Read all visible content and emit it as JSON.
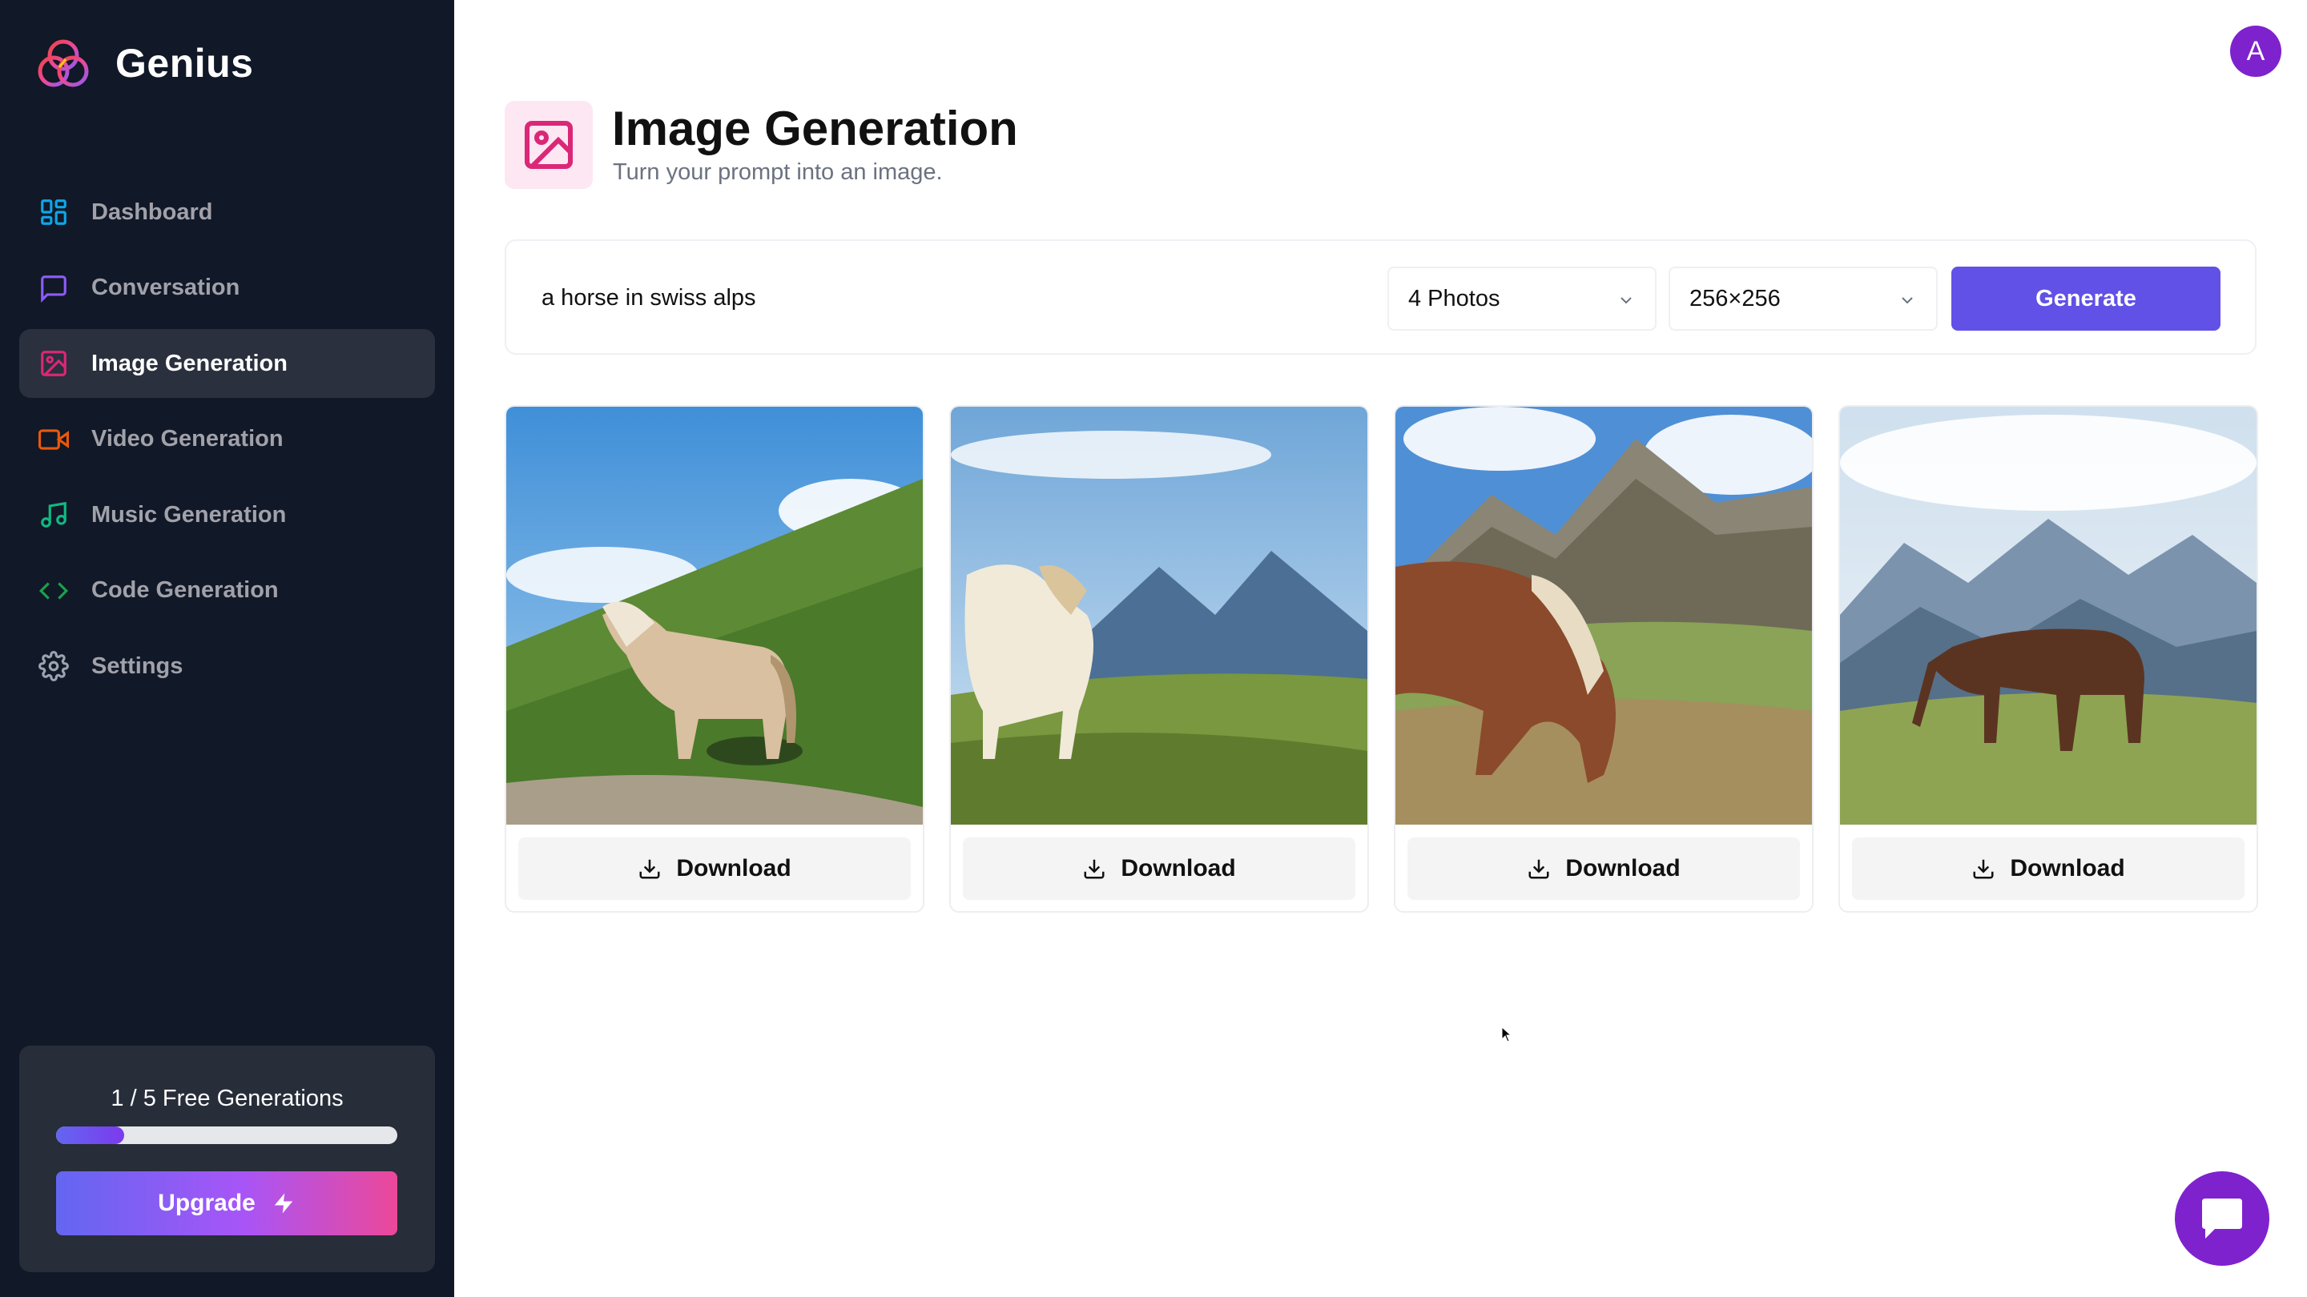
{
  "app": {
    "name": "Genius"
  },
  "sidebar": {
    "items": [
      {
        "label": "Dashboard",
        "icon": "dashboard-icon",
        "color": "#0ea5e9",
        "active": false
      },
      {
        "label": "Conversation",
        "icon": "message-square-icon",
        "color": "#8b5cf6",
        "active": false
      },
      {
        "label": "Image Generation",
        "icon": "image-icon",
        "color": "#db2777",
        "active": true
      },
      {
        "label": "Video Generation",
        "icon": "video-icon",
        "color": "#ea580c",
        "active": false
      },
      {
        "label": "Music Generation",
        "icon": "music-icon",
        "color": "#10b981",
        "active": false
      },
      {
        "label": "Code Generation",
        "icon": "code-icon",
        "color": "#16a34a",
        "active": false
      },
      {
        "label": "Settings",
        "icon": "settings-icon",
        "color": "#9ca3af",
        "active": false
      }
    ]
  },
  "usage": {
    "label": "1 / 5 Free Generations",
    "used": 1,
    "limit": 5,
    "upgrade_label": "Upgrade"
  },
  "user": {
    "avatar_letter": "A"
  },
  "header": {
    "title": "Image Generation",
    "subtitle": "Turn your prompt into an image."
  },
  "form": {
    "prompt_value": "a horse in swiss alps",
    "amount_selected": "4 Photos",
    "resolution_selected": "256×256",
    "generate_label": "Generate"
  },
  "results": [
    {
      "download_label": "Download"
    },
    {
      "download_label": "Download"
    },
    {
      "download_label": "Download"
    },
    {
      "download_label": "Download"
    }
  ],
  "colors": {
    "sidebar_bg": "#111827",
    "accent": "#6151e6",
    "image_accent": "#db2777"
  }
}
